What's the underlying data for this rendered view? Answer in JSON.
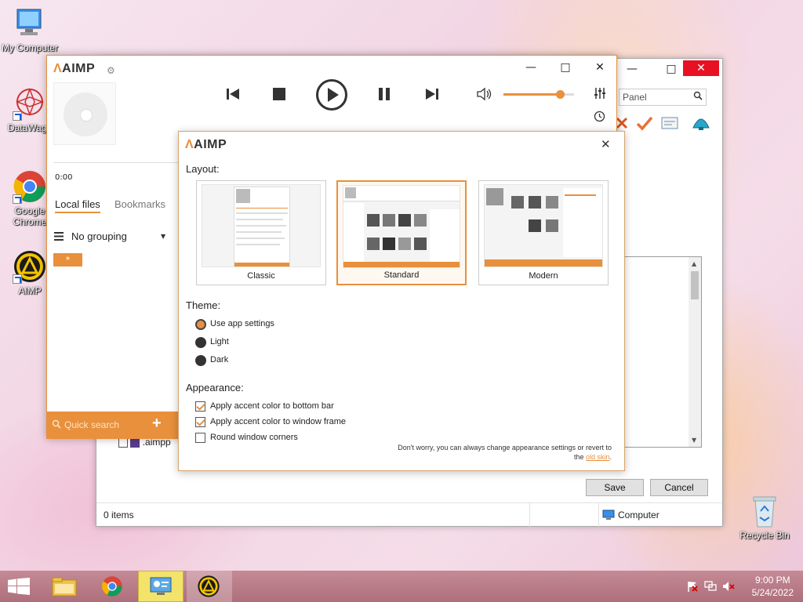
{
  "desktop": {
    "icons": [
      {
        "label": "My Computer"
      },
      {
        "label": "DataWago"
      },
      {
        "label": "Google Chrome"
      },
      {
        "label": "AIMP"
      },
      {
        "label": "Recycle Bin"
      }
    ]
  },
  "explorer": {
    "search_placeholder": "Panel",
    "status_items": "0 items",
    "status_location": "Computer",
    "save_label": "Save",
    "cancel_label": "Cancel",
    "file_name": ".aimpp"
  },
  "aimp": {
    "logo": "AIMP",
    "time": "0:00",
    "tabs": [
      "Local files",
      "Bookmarks"
    ],
    "grouping_label": "No grouping",
    "group_tag": "*",
    "quick_search_placeholder": "Quick search",
    "volume_percent": 80
  },
  "dialog": {
    "logo": "AIMP",
    "layout_title": "Layout:",
    "layouts": [
      {
        "name": "Classic",
        "selected": false
      },
      {
        "name": "Standard",
        "selected": true
      },
      {
        "name": "Modern",
        "selected": false
      }
    ],
    "theme_title": "Theme:",
    "themes": [
      {
        "label": "Use app settings",
        "selected": true
      },
      {
        "label": "Light",
        "selected": false
      },
      {
        "label": "Dark",
        "selected": false
      }
    ],
    "appearance_title": "Appearance:",
    "appearance_options": [
      {
        "label": "Apply accent color to bottom bar",
        "checked": true
      },
      {
        "label": "Apply accent color to window frame",
        "checked": true
      },
      {
        "label": "Round window corners",
        "checked": false
      }
    ],
    "note_line1": "Don't worry, you can always change appearance settings or revert to",
    "note_line2_prefix": "the ",
    "note_link": "old skin",
    "note_suffix": "."
  },
  "taskbar": {
    "time": "9:00 PM",
    "date": "5/24/2022"
  },
  "colors": {
    "accent": "#e8903c",
    "taskbar": "#b97a86"
  }
}
